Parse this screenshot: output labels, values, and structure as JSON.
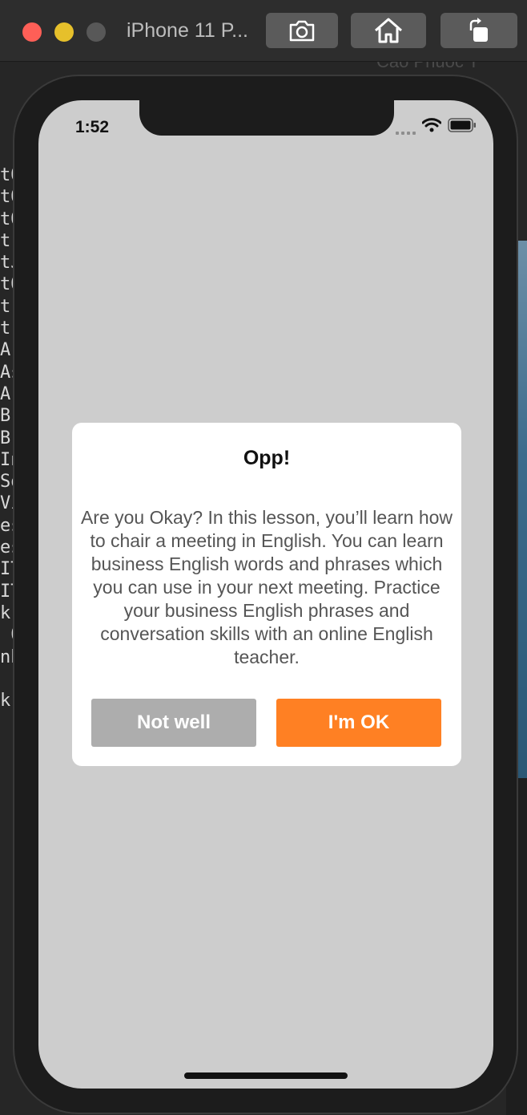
{
  "simulator": {
    "window_title": "iPhone 11 P...",
    "toolbar": {
      "screenshot_icon": "camera-icon",
      "home_icon": "home-icon",
      "rotate_icon": "rotate-icon"
    },
    "background_window_title": "Cao Phuoc T"
  },
  "status_bar": {
    "time": "1:52"
  },
  "alert": {
    "title": "Opp!",
    "message": "Are you Okay? In this lesson, you’ll learn how to chair a meeting in English. You can learn business English words and phrases which you can use in your next meeting. Practice your business English phrases and conversation skills with an online English teacher.",
    "secondary_button": "Not well",
    "primary_button": "I'm OK"
  },
  "colors": {
    "primary_button": "#ff8023",
    "secondary_button": "#adadad",
    "screen_background": "#cdcdcd"
  }
}
